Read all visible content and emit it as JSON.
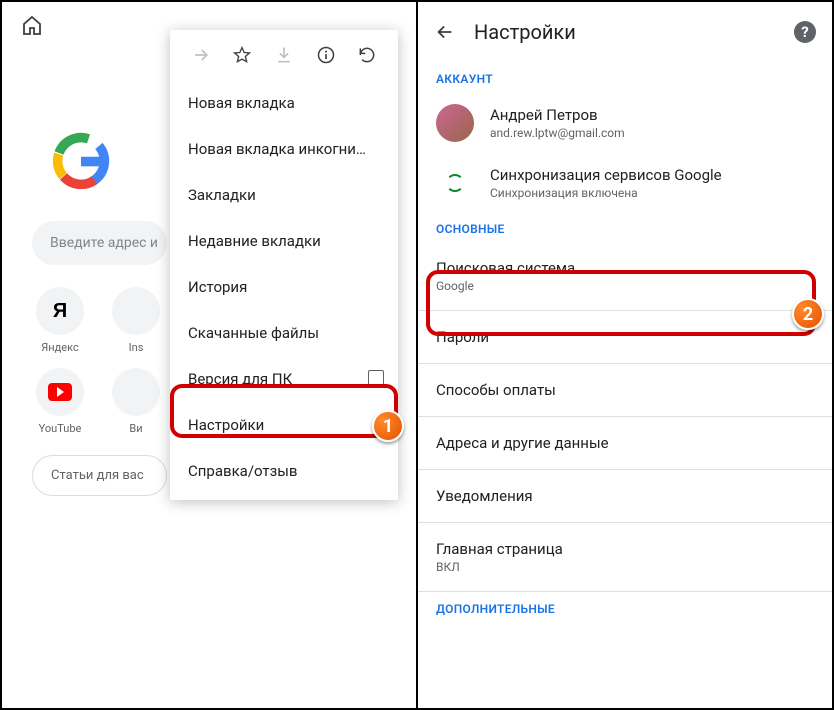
{
  "left": {
    "search_placeholder": "Введите адрес и",
    "tiles": [
      {
        "label": "Яндекс",
        "kind": "yandex"
      },
      {
        "label": "Ins",
        "kind": "generic"
      }
    ],
    "tiles2": [
      {
        "label": "YouTube",
        "kind": "youtube"
      },
      {
        "label": "Ви",
        "kind": "generic"
      }
    ],
    "feed_label": "Статьи для вас",
    "menu": {
      "items": [
        "Новая вкладка",
        "Новая вкладка инкогни…",
        "Закладки",
        "Недавние вкладки",
        "История",
        "Скачанные файлы",
        "Версия для ПК",
        "Настройки",
        "Справка/отзыв"
      ],
      "desktop_checked": false
    },
    "callout_number": "1"
  },
  "right": {
    "title": "Настройки",
    "account_section": "АККАУНТ",
    "user": {
      "name": "Андрей Петров",
      "email": "and.rew.lptw@gmail.com"
    },
    "sync": {
      "title": "Синхронизация сервисов Google",
      "status": "Синхронизация включена"
    },
    "basics_section": "ОСНОВНЫЕ",
    "search_engine": {
      "label": "Поисковая система",
      "value": "Google"
    },
    "rows": {
      "passwords": "Пароли",
      "payments": "Способы оплаты",
      "addresses": "Адреса и другие данные",
      "notifications": "Уведомления"
    },
    "homepage": {
      "label": "Главная страница",
      "value": "ВКЛ"
    },
    "advanced_section": "ДОПОЛНИТЕЛЬНЫЕ",
    "callout_number": "2"
  }
}
